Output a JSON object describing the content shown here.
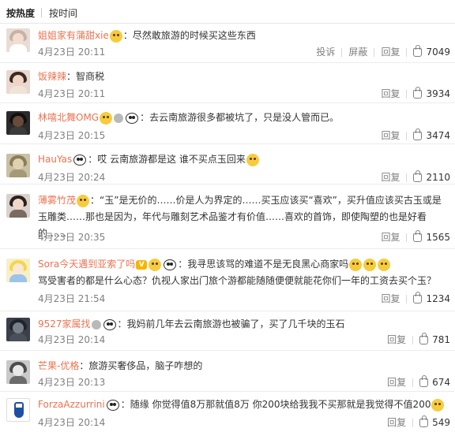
{
  "sort": {
    "hot": "按热度",
    "time": "按时间"
  },
  "actions": {
    "report": "投诉",
    "block": "屏蔽",
    "reply": "回复"
  },
  "comments": [
    {
      "user": "姐姐家有蒲甜xie",
      "text": "：尽然敢旅游的时候买这些东西",
      "time": "4月23日 20:11",
      "likes": "7049"
    },
    {
      "user": "饭辣辣",
      "text": "：智商税",
      "time": "4月23日 20:11",
      "likes": "3934"
    },
    {
      "user": "林嘻北舞OMG",
      "text": "：去云南旅游很多都被坑了，只是没人管而已。",
      "time": "4月23日 20:15",
      "likes": "3474"
    },
    {
      "user": "HauYas",
      "text": "：哎 云南旅游都是这 谁不买点玉回来",
      "time": "4月23日 20:24",
      "likes": "2110"
    },
    {
      "user": "薄雾竹茂",
      "text": "：“玉”是无价的……价是人为界定的……买玉应该买“喜欢”，买升值应该买古玉或是玉雕类……那也是因为，年代与雕刻艺术品鉴才有价值……喜欢的首饰，即使陶塑的也是好看的……",
      "time": "4月23日 20:35",
      "likes": "1565"
    },
    {
      "user": "Sora今天遇到亚索了吗",
      "text": "：我寻思该骂的难道不是无良黑心商家吗",
      "text2": "骂受害者的都是什么心态？仇视人家出门旅个游都能随随便便就能花你们一年的工资去买个玉？",
      "time": "4月23日 21:54",
      "likes": "1234"
    },
    {
      "user": "9527家属找",
      "text": "：我妈前几年去云南旅游也被骗了，买了几千块的玉石",
      "time": "4月23日 20:14",
      "likes": "781"
    },
    {
      "user": "芒果-优格",
      "text": "：旅游买奢侈品，脑子咋想的",
      "time": "4月23日 20:13",
      "likes": "674"
    },
    {
      "user": "ForzaAzzurrini",
      "text": "：随缘 你觉得值8万那就值8万 你200块给我我不买那就是我觉得不值200",
      "time": "4月23日 20:14",
      "likes": "549"
    }
  ]
}
